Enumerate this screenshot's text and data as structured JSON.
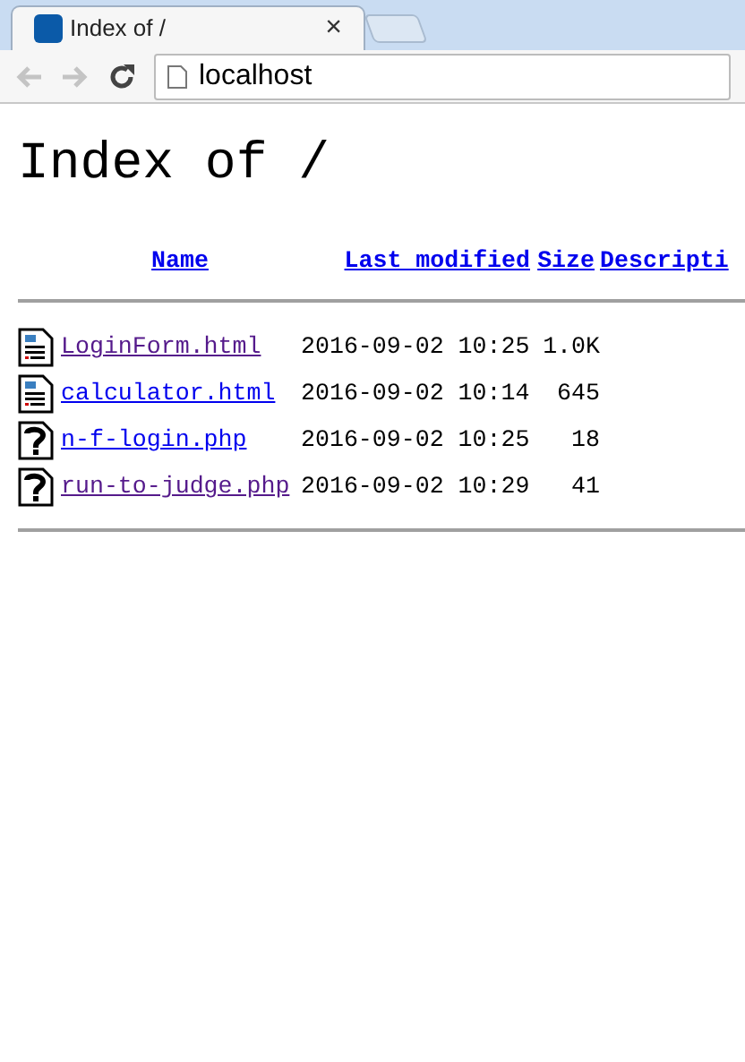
{
  "tab": {
    "title": "Index of /",
    "close": "×"
  },
  "address": {
    "value": "localhost"
  },
  "heading": "Index of /",
  "table": {
    "columns": [
      "Name",
      "Last modified",
      "Size",
      "Descripti"
    ],
    "rows": [
      {
        "kind": "html",
        "name": "LoginForm.html",
        "visited": true,
        "modified": "2016-09-02 10:25",
        "size": "1.0K"
      },
      {
        "kind": "html",
        "name": "calculator.html",
        "visited": false,
        "modified": "2016-09-02 10:14",
        "size": "645"
      },
      {
        "kind": "unknown",
        "name": "n-f-login.php",
        "visited": false,
        "modified": "2016-09-02 10:25",
        "size": "18"
      },
      {
        "kind": "unknown",
        "name": "run-to-judge.php",
        "visited": true,
        "modified": "2016-09-02 10:29",
        "size": "41"
      }
    ]
  }
}
